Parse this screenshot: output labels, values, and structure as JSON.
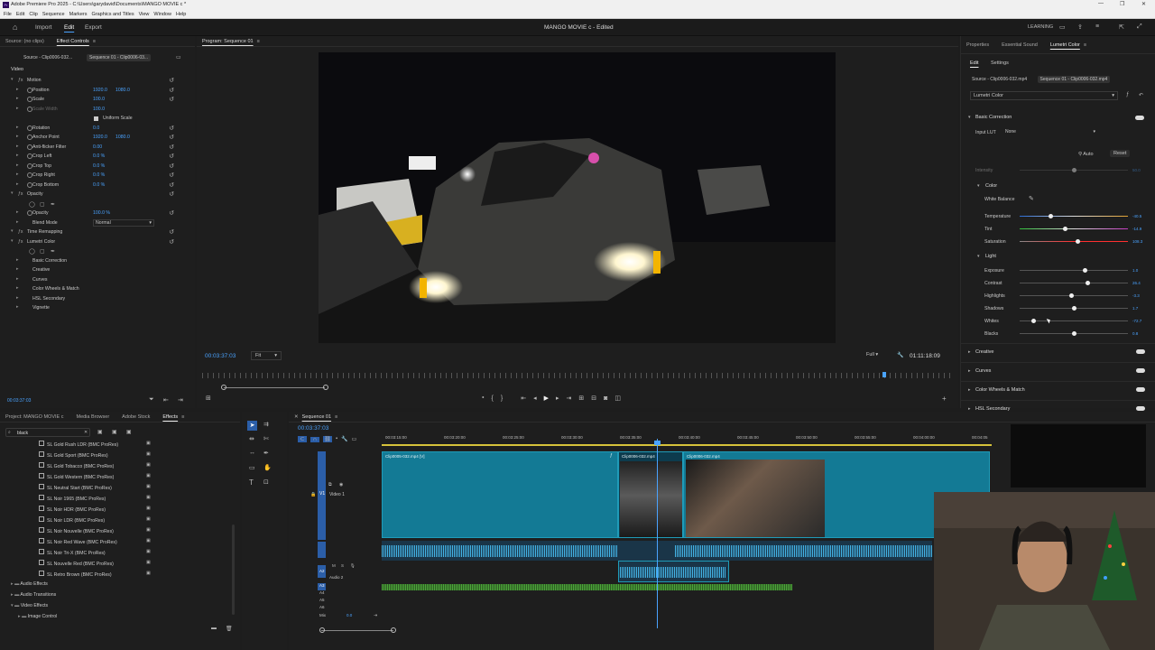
{
  "window": {
    "title": "Adobe Premiere Pro 2025 - C:\\Users\\garydavid\\Documents\\MANGO MOVIE c *",
    "controls": [
      "—",
      "❐",
      "✕"
    ]
  },
  "menu": [
    "File",
    "Edit",
    "Clip",
    "Sequence",
    "Markers",
    "Graphics and Titles",
    "View",
    "Window",
    "Help"
  ],
  "header": {
    "nav": {
      "import": "Import",
      "edit": "Edit",
      "export": "Export"
    },
    "project_title": "MANGO MOVIE c - Edited",
    "learning": "LEARNING"
  },
  "effect_controls": {
    "tabs": {
      "source": "Source: (no clips)",
      "effect_controls": "Effect Controls"
    },
    "clip_tabs": {
      "source": "Source - Clip0006-032...",
      "sequence": "Sequence 01 - Clip0006-03..."
    },
    "section_video": "Video",
    "rows": [
      {
        "label": "Motion",
        "indent": 1,
        "fx": true,
        "value1": "",
        "value2": ""
      },
      {
        "label": "Position",
        "indent": 2,
        "value1": "1920.0",
        "value2": "1080.0"
      },
      {
        "label": "Scale",
        "indent": 2,
        "value1": "100.0",
        "value2": ""
      },
      {
        "label": "Scale Width",
        "indent": 2,
        "dim": true,
        "value1": "100.0",
        "value2": ""
      },
      {
        "label": "Uniform Scale",
        "indent": 3,
        "check": true,
        "value1": "",
        "value2": ""
      },
      {
        "label": "Rotation",
        "indent": 2,
        "value1": "0.0",
        "value2": ""
      },
      {
        "label": "Anchor Point",
        "indent": 2,
        "value1": "1920.0",
        "value2": "1080.0"
      },
      {
        "label": "Anti-flicker Filter",
        "indent": 2,
        "value1": "0.00",
        "value2": ""
      },
      {
        "label": "Crop Left",
        "indent": 2,
        "value1": "0.0 %",
        "value2": ""
      },
      {
        "label": "Crop Top",
        "indent": 2,
        "value1": "0.0 %",
        "value2": ""
      },
      {
        "label": "Crop Right",
        "indent": 2,
        "value1": "0.0 %",
        "value2": ""
      },
      {
        "label": "Crop Bottom",
        "indent": 2,
        "value1": "0.0 %",
        "value2": ""
      },
      {
        "label": "Opacity",
        "indent": 1,
        "fx": true,
        "value1": "",
        "value2": ""
      },
      {
        "label": "",
        "indent": 2,
        "shapes": true,
        "value1": "",
        "value2": ""
      },
      {
        "label": "Opacity",
        "indent": 2,
        "value1": "100.0 %",
        "value2": ""
      },
      {
        "label": "Blend Mode",
        "indent": 2,
        "value1": "",
        "value2": ""
      },
      {
        "label": "Time Remapping",
        "indent": 1,
        "fx": true,
        "value1": "",
        "value2": ""
      },
      {
        "label": "Lumetri Color",
        "indent": 1,
        "fx": true,
        "value1": "",
        "value2": ""
      },
      {
        "label": "",
        "indent": 2,
        "shapes": true,
        "value1": "",
        "value2": ""
      },
      {
        "label": "Basic Correction",
        "indent": 2,
        "value1": "",
        "value2": ""
      },
      {
        "label": "Creative",
        "indent": 2,
        "value1": "",
        "value2": ""
      },
      {
        "label": "Curves",
        "indent": 2,
        "value1": "",
        "value2": ""
      },
      {
        "label": "Color Wheels & Match",
        "indent": 2,
        "value1": "",
        "value2": ""
      },
      {
        "label": "HSL Secondary",
        "indent": 2,
        "value1": "",
        "value2": ""
      },
      {
        "label": "Vignette",
        "indent": 2,
        "value1": "",
        "value2": ""
      }
    ],
    "blend_mode": "Normal",
    "timecode": "00:03:37:03"
  },
  "program": {
    "tab": "Program: Sequence 01",
    "timecode": "00:03:37:03",
    "fit": "Fit",
    "resolution": "Full",
    "duration": "01:11:18:09"
  },
  "lumetri": {
    "tabs": {
      "properties": "Properties",
      "essential_sound": "Essential Sound",
      "lumetri_color": "Lumetri Color"
    },
    "subtabs": {
      "edit": "Edit",
      "settings": "Settings"
    },
    "clip_tabs": {
      "source": "Source - Clip0006-032.mp4",
      "sequence": "Sequence 01 - Clip0006-032.mp4"
    },
    "effect_select": "Lumetri Color",
    "basic_correction": "Basic Correction",
    "input_lut_label": "Input LUT",
    "input_lut": "None",
    "auto": "Auto",
    "reset": "Reset",
    "intensity": {
      "label": "Intensity",
      "value": "50.0",
      "pos": 0.5
    },
    "color_header": "Color",
    "white_balance": "White Balance",
    "color_sliders": [
      {
        "label": "Temperature",
        "value": "-40.5",
        "pos": 0.29
      },
      {
        "label": "Tint",
        "value": "-14.9",
        "pos": 0.42
      },
      {
        "label": "Saturation",
        "value": "108.3",
        "pos": 0.54
      }
    ],
    "light_header": "Light",
    "light_sliders": [
      {
        "label": "Exposure",
        "value": "1.0",
        "pos": 0.6
      },
      {
        "label": "Contrast",
        "value": "26.4",
        "pos": 0.63
      },
      {
        "label": "Highlights",
        "value": "-3.3",
        "pos": 0.48
      },
      {
        "label": "Shadows",
        "value": "1.7",
        "pos": 0.5
      },
      {
        "label": "Whites",
        "value": "-72.7",
        "pos": 0.13
      },
      {
        "label": "Blacks",
        "value": "0.8",
        "pos": 0.5
      }
    ],
    "sections": [
      "Creative",
      "Curves",
      "Color Wheels & Match",
      "HSL Secondary"
    ]
  },
  "project": {
    "tabs": {
      "project": "Project: MANGO MOVIE c",
      "media_browser": "Media Browser",
      "adobe_stock": "Adobe Stock",
      "effects": "Effects"
    },
    "search_value": "black",
    "effects": [
      "SL Gold Rush LDR (BMC ProRes)",
      "SL Gold Sport (BMC ProRes)",
      "SL Gold Tobacco (BMC ProRes)",
      "SL Gold Western (BMC ProRes)",
      "SL Neutral Start (BMC ProRes)",
      "SL Noir 1965 (BMC ProRes)",
      "SL Noir HDR (BMC ProRes)",
      "SL Noir LDR (BMC ProRes)",
      "SL Noir Nouvelle (BMC ProRes)",
      "SL Noir Red Wave (BMC ProRes)",
      "SL Noir Tri-X (BMC ProRes)",
      "SL Nouvelle Red (BMC ProRes)",
      "SL Retro Brown (BMC ProRes)"
    ],
    "bins": [
      "Audio Effects",
      "Audio Transitions",
      "Video Effects",
      "Image Control"
    ]
  },
  "timeline": {
    "tab": "Sequence 01",
    "timecode": "00:03:37:03",
    "ruler": [
      "00:03:15:00",
      "00:03:20:00",
      "00:03:25:00",
      "00:03:30:00",
      "00:03:35:00",
      "00:03:40:00",
      "00:03:45:00",
      "00:03:50:00",
      "00:03:55:00",
      "00:04:00:00",
      "00:04:05"
    ],
    "tracks": {
      "v1": "V1",
      "video1": "Video 1",
      "a1": "A1",
      "a2": "A2",
      "audio2": "Audio 2",
      "a3": "A3",
      "a4": "A4",
      "a5": "A5",
      "a6": "A6",
      "mix": "Mix",
      "mix_value": "0.0"
    },
    "clips": {
      "c1": "Clip0005-032.mp4 [V]",
      "c2": "Clip0006-032.mp4",
      "c3": "Clip0006-032.mp4"
    }
  },
  "colors": {
    "accent_blue": "#4aa3ff",
    "video_clip": "#137a95",
    "audio_wave": "#44b5e8",
    "green_track": "#4ca63a"
  }
}
